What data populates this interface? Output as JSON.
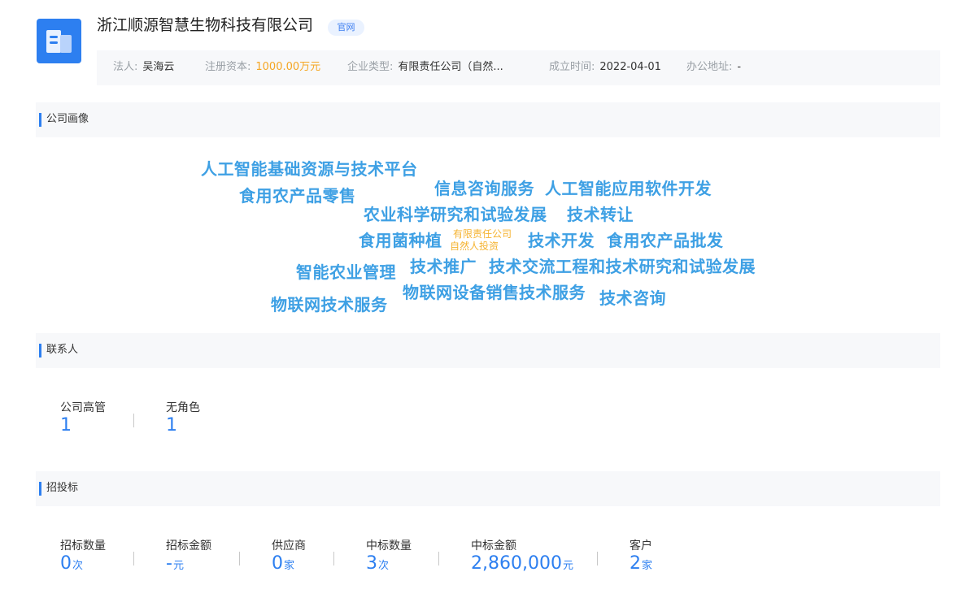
{
  "company": {
    "name": "浙江顺源智慧生物科技有限公司",
    "official_site_tag": "官网"
  },
  "info": {
    "legal_person_label": "法人:",
    "legal_person": "吴海云",
    "capital_label": "注册资本:",
    "capital": "1000.00万元",
    "type_label": "企业类型:",
    "type": "有限责任公司（自然...",
    "founded_label": "成立时间:",
    "founded": "2022-04-01",
    "address_label": "办公地址:",
    "address": "-"
  },
  "sections": {
    "portrait": "公司画像",
    "contacts": "联系人",
    "bidding": "招投标"
  },
  "word_cloud": {
    "w1": "人工智能基础资源与技术平台",
    "w2": "信息咨询服务",
    "w3": "人工智能应用软件开发",
    "w4": "食用农产品零售",
    "w5": "农业科学研究和试验发展",
    "w6": "技术转让",
    "w7": "食用菌种植",
    "w8a": "有限责任公司",
    "w8b": "自然人投资",
    "w9": "技术开发",
    "w10": "食用农产品批发",
    "w11": "智能农业管理",
    "w12": "技术推广",
    "w13": "技术交流工程和技术研究和试验发展",
    "w14": "物联网设备销售",
    "w15": "技术服务",
    "w16": "技术咨询",
    "w17": "物联网技术服务"
  },
  "contacts": {
    "executives_label": "公司高管",
    "executives_value": "1",
    "no_role_label": "无角色",
    "no_role_value": "1"
  },
  "bidding": {
    "tender_count_label": "招标数量",
    "tender_count": "0",
    "tender_count_unit": "次",
    "tender_amount_label": "招标金额",
    "tender_amount": "-",
    "tender_amount_unit": "元",
    "supplier_label": "供应商",
    "supplier": "0",
    "supplier_unit": "家",
    "win_count_label": "中标数量",
    "win_count": "3",
    "win_count_unit": "次",
    "win_amount_label": "中标金额",
    "win_amount": "2,860,000",
    "win_amount_unit": "元",
    "customer_label": "客户",
    "customer": "2",
    "customer_unit": "家"
  }
}
